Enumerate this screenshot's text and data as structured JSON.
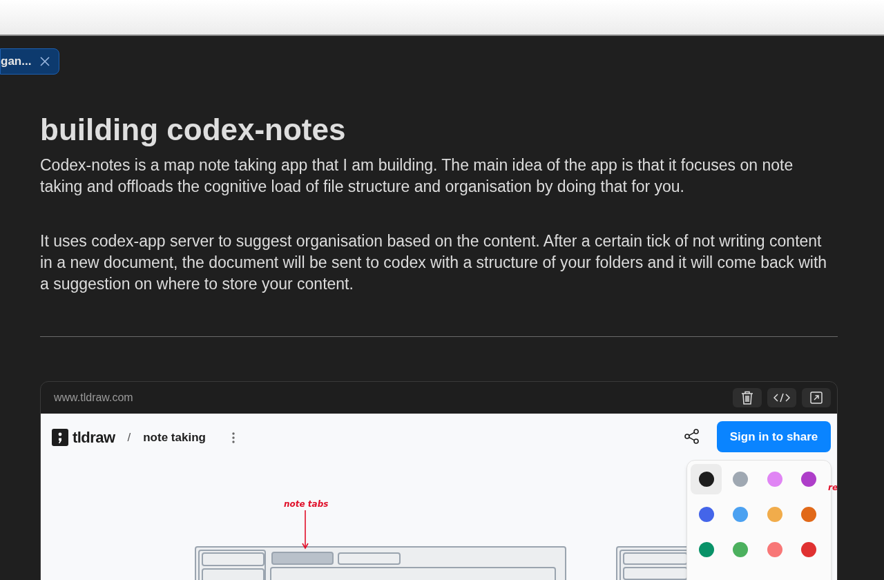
{
  "tab": {
    "label": "gan...",
    "selected": true
  },
  "article": {
    "title": "building codex-notes",
    "paragraphs": [
      "Codex-notes is a map note taking app that I am building. The main idea of the app is that it focuses on note taking and offloads the cognitive load of file structure and organisation by doing that for you.",
      "It uses codex-app server to suggest organisation based on the content. After a certain tick of not writing content in a new document, the document will be sent to codex with a structure of your folders and it will come back with a suggestion on where to store your content."
    ]
  },
  "embed": {
    "url": "www.tldraw.com",
    "app": {
      "logo": "tldraw",
      "separator": "/",
      "document": "note taking",
      "share_button": "Sign in to share",
      "annotations": [
        "note tabs",
        "re"
      ],
      "colors": [
        {
          "color": "#1d1d1d",
          "selected": true
        },
        {
          "color": "#9fa8b2",
          "selected": false
        },
        {
          "color": "#e085f4",
          "selected": false
        },
        {
          "color": "#ae3ec9",
          "selected": false
        },
        {
          "color": "#4465e9",
          "selected": false
        },
        {
          "color": "#4ba1f1",
          "selected": false
        },
        {
          "color": "#f1ac4b",
          "selected": false
        },
        {
          "color": "#e16919",
          "selected": false
        },
        {
          "color": "#099268",
          "selected": false
        },
        {
          "color": "#4cb05e",
          "selected": false
        },
        {
          "color": "#f87777",
          "selected": false
        },
        {
          "color": "#e03131",
          "selected": false
        }
      ]
    }
  }
}
